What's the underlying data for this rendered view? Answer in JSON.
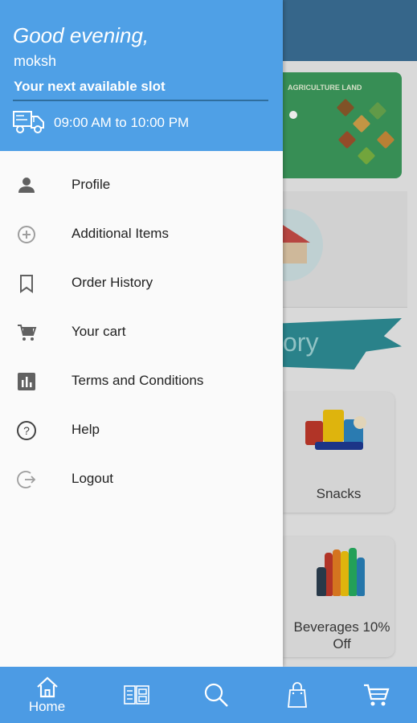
{
  "drawer": {
    "greeting": "Good evening,",
    "username": "moksh",
    "slot_title": "Your next available slot",
    "slot_time": "09:00 AM to 10:00 PM",
    "menu": [
      {
        "label": "Profile",
        "icon": "person-icon"
      },
      {
        "label": "Additional Items",
        "icon": "add-circle-icon"
      },
      {
        "label": "Order History",
        "icon": "bookmark-icon"
      },
      {
        "label": "Your cart",
        "icon": "cart-icon"
      },
      {
        "label": "Terms and Conditions",
        "icon": "bar-chart-icon"
      },
      {
        "label": "Help",
        "icon": "help-icon"
      },
      {
        "label": "Logout",
        "icon": "logout-icon"
      }
    ]
  },
  "background": {
    "banner_text": "AGRICULTURE LAND",
    "section_text": "ory",
    "cards": [
      {
        "label": "Snacks"
      },
      {
        "label": "Beverages 10% Off"
      }
    ]
  },
  "bottom_nav": {
    "home_label": "Home",
    "items": [
      "home-icon",
      "catalog-icon",
      "search-icon",
      "bag-icon",
      "cart-icon"
    ]
  },
  "colors": {
    "accent": "#4fa0e6",
    "nav": "#4c9be4",
    "drawer_bg": "#fafafa"
  }
}
